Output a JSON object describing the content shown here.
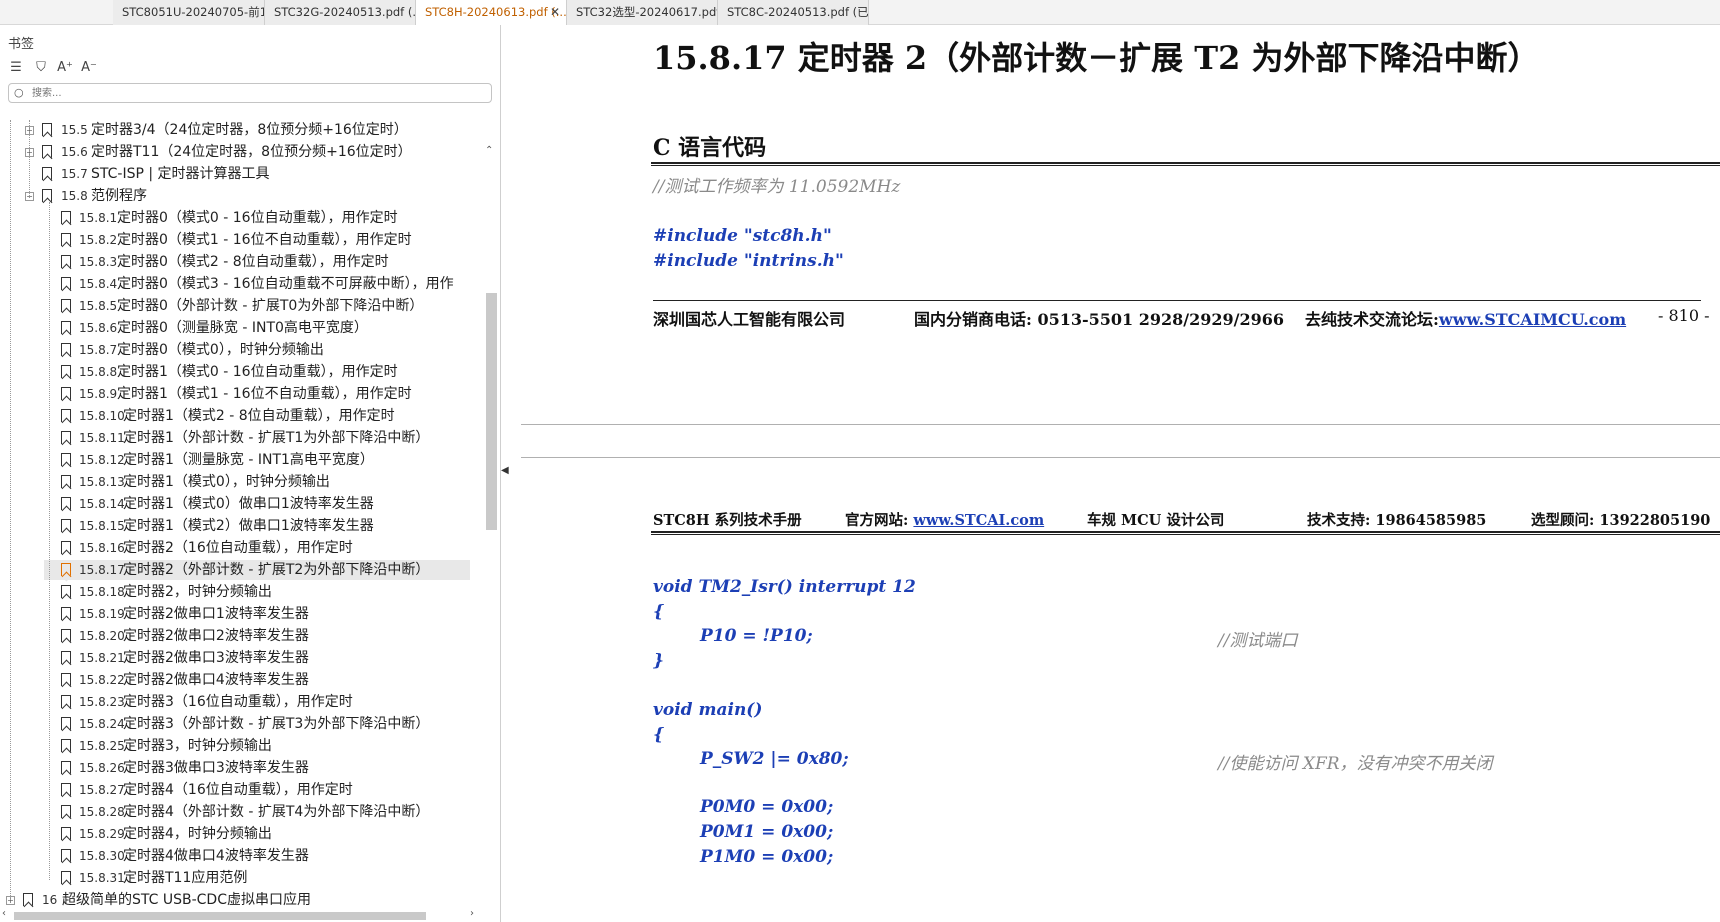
{
  "tabs": [
    {
      "label": "STC8051U-20240705-前1..."
    },
    {
      "label": "STC32G-20240513.pdf (..."
    },
    {
      "label": "STC8H-20240613.pdf (...",
      "active": true
    },
    {
      "label": "STC32选型-20240617.pdf"
    },
    {
      "label": "STC8C-20240513.pdf (已..."
    }
  ],
  "sidebar": {
    "title": "书签",
    "search_placeholder": "搜索...",
    "items": [
      {
        "num": "15.5",
        "text": "定时器3/4（24位定时器，8位预分频+16位定时）",
        "level": 1,
        "expand": "+"
      },
      {
        "num": "15.6",
        "text": "定时器T11（24位定时器，8位预分频+16位定时）",
        "level": 1,
        "expand": "+"
      },
      {
        "num": "15.7",
        "text": "STC-ISP | 定时器计算器工具",
        "level": 1,
        "expand": ""
      },
      {
        "num": "15.8",
        "text": "范例程序",
        "level": 1,
        "expand": "-"
      },
      {
        "num": "15.8.1",
        "text": "定时器0（模式0 - 16位自动重载），用作定时",
        "level": 2
      },
      {
        "num": "15.8.2",
        "text": "定时器0（模式1 - 16位不自动重载），用作定时",
        "level": 2
      },
      {
        "num": "15.8.3",
        "text": "定时器0（模式2 - 8位自动重载），用作定时",
        "level": 2
      },
      {
        "num": "15.8.4",
        "text": "定时器0（模式3 - 16位自动重载不可屏蔽中断），用作",
        "level": 2
      },
      {
        "num": "15.8.5",
        "text": "定时器0（外部计数 - 扩展T0为外部下降沿中断）",
        "level": 2
      },
      {
        "num": "15.8.6",
        "text": "定时器0（测量脉宽 - INT0高电平宽度）",
        "level": 2
      },
      {
        "num": "15.8.7",
        "text": "定时器0（模式0），时钟分频输出",
        "level": 2
      },
      {
        "num": "15.8.8",
        "text": "定时器1（模式0 - 16位自动重载），用作定时",
        "level": 2
      },
      {
        "num": "15.8.9",
        "text": "定时器1（模式1 - 16位不自动重载），用作定时",
        "level": 2
      },
      {
        "num": "15.8.10",
        "text": "定时器1（模式2 - 8位自动重载），用作定时",
        "level": 2
      },
      {
        "num": "15.8.11",
        "text": "定时器1（外部计数 - 扩展T1为外部下降沿中断）",
        "level": 2
      },
      {
        "num": "15.8.12",
        "text": "定时器1（测量脉宽 - INT1高电平宽度）",
        "level": 2
      },
      {
        "num": "15.8.13",
        "text": "定时器1（模式0），时钟分频输出",
        "level": 2
      },
      {
        "num": "15.8.14",
        "text": "定时器1（模式0）做串口1波特率发生器",
        "level": 2
      },
      {
        "num": "15.8.15",
        "text": "定时器1（模式2）做串口1波特率发生器",
        "level": 2
      },
      {
        "num": "15.8.16",
        "text": "定时器2（16位自动重载），用作定时",
        "level": 2
      },
      {
        "num": "15.8.17",
        "text": "定时器2（外部计数 - 扩展T2为外部下降沿中断）",
        "level": 2,
        "selected": true
      },
      {
        "num": "15.8.18",
        "text": "定时器2，时钟分频输出",
        "level": 2
      },
      {
        "num": "15.8.19",
        "text": "定时器2做串口1波特率发生器",
        "level": 2
      },
      {
        "num": "15.8.20",
        "text": "定时器2做串口2波特率发生器",
        "level": 2
      },
      {
        "num": "15.8.21",
        "text": "定时器2做串口3波特率发生器",
        "level": 2
      },
      {
        "num": "15.8.22",
        "text": "定时器2做串口4波特率发生器",
        "level": 2
      },
      {
        "num": "15.8.23",
        "text": "定时器3（16位自动重载），用作定时",
        "level": 2
      },
      {
        "num": "15.8.24",
        "text": "定时器3（外部计数 - 扩展T3为外部下降沿中断）",
        "level": 2
      },
      {
        "num": "15.8.25",
        "text": "定时器3，时钟分频输出",
        "level": 2
      },
      {
        "num": "15.8.26",
        "text": "定时器3做串口3波特率发生器",
        "level": 2
      },
      {
        "num": "15.8.27",
        "text": "定时器4（16位自动重载），用作定时",
        "level": 2
      },
      {
        "num": "15.8.28",
        "text": "定时器4（外部计数 - 扩展T4为外部下降沿中断）",
        "level": 2
      },
      {
        "num": "15.8.29",
        "text": "定时器4，时钟分频输出",
        "level": 2
      },
      {
        "num": "15.8.30",
        "text": "定时器4做串口4波特率发生器",
        "level": 2
      },
      {
        "num": "15.8.31",
        "text": "定时器T11应用范例",
        "level": 2
      },
      {
        "num": "16",
        "text": "超级简单的STC USB-CDC虚拟串口应用",
        "level": 0,
        "expand": "+"
      }
    ]
  },
  "page1": {
    "section_title": "15.8.17   定时器 2（外部计数－扩展 T2 为外部下降沿中断）",
    "c_code_heading": "C 语言代码",
    "comment_freq": "//测试工作频率为 11.0592MHz",
    "include1": "#include \"stc8h.h\"",
    "include2": "#include \"intrins.h\"",
    "footer_company": "深圳国芯人工智能有限公司",
    "footer_phone": "国内分销商电话: 0513-5501 2928/2929/2966",
    "footer_forum_label": "去纯技术交流论坛:",
    "footer_forum_url": "www.STCAIMCU.com",
    "footer_page": "- 810 -"
  },
  "page2": {
    "hdr_manual": "STC8H 系列技术手册",
    "hdr_site_label": "官方网站: ",
    "hdr_site_url": "www.STCAI.com",
    "hdr_company": "车规 MCU 设计公司",
    "hdr_support": "技术支持: 19864585985",
    "hdr_advisor": "选型顾问: 13922805190",
    "code": [
      "void TM2_Isr() interrupt 12",
      "{",
      "P10 = !P10;",
      "}",
      "void main()",
      "{",
      "P_SW2 |= 0x80;",
      "P0M0 = 0x00;",
      "P0M1 = 0x00;",
      "P1M0 = 0x00;"
    ],
    "comment_test_port": "//测试端口",
    "comment_xfr": "//使能访问 XFR，没有冲突不用关闭"
  }
}
